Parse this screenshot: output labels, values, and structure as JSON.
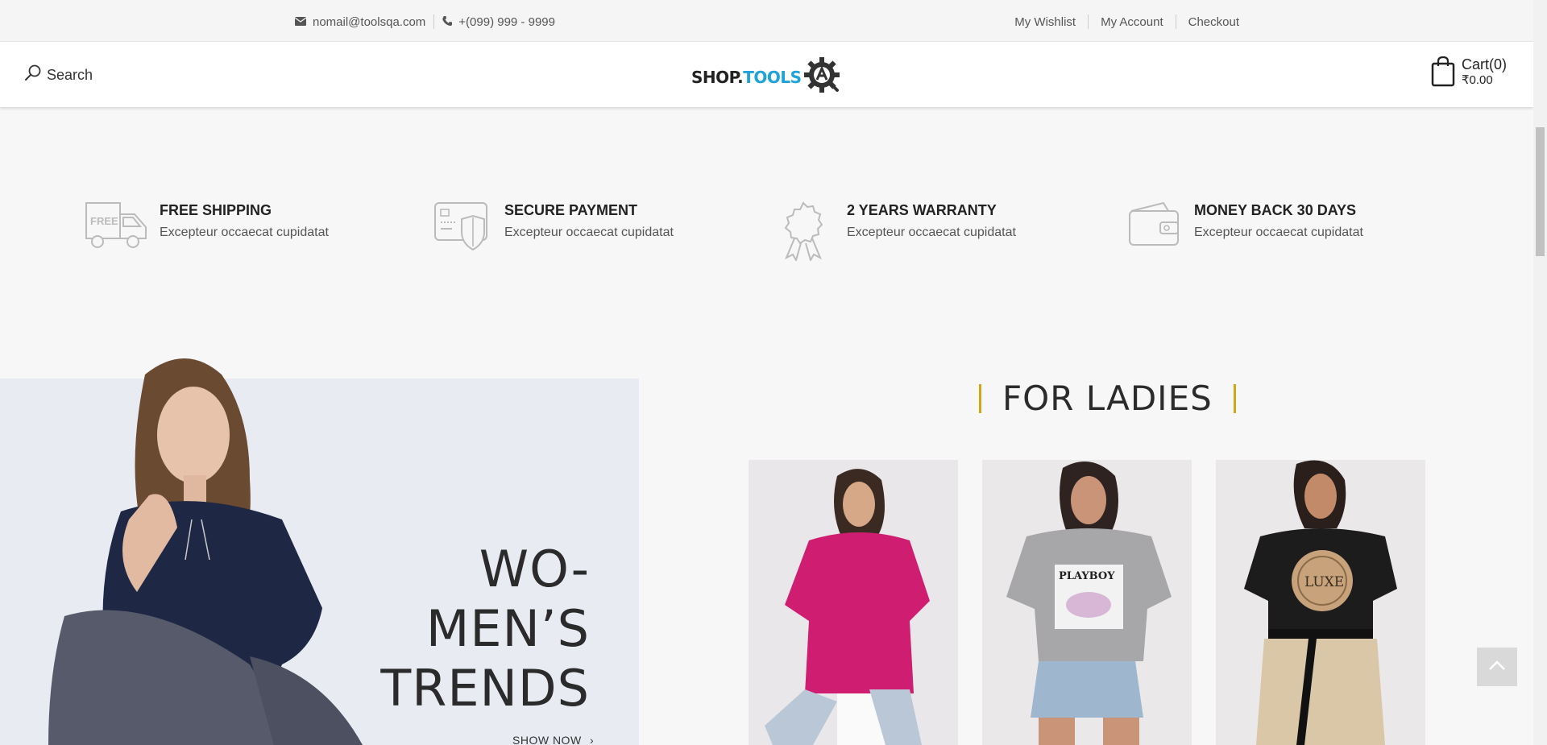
{
  "topbar": {
    "email": "nomail@toolsqa.com",
    "phone": "+(099) 999 - 9999",
    "links": [
      "My Wishlist",
      "My Account",
      "Checkout"
    ]
  },
  "header": {
    "search_label": "Search",
    "logo_shop": "SHOP.",
    "logo_tools": "TOOLS",
    "cart_label": "Cart(0)",
    "cart_total": "₹0.00"
  },
  "features": [
    {
      "title": "FREE SHIPPING",
      "desc": "Excepteur occaecat cupidatat",
      "icon": "truck-icon",
      "badge": "FREE"
    },
    {
      "title": "SECURE PAYMENT",
      "desc": "Excepteur occaecat cupidatat",
      "icon": "card-shield-icon"
    },
    {
      "title": "2 YEARS WARRANTY",
      "desc": "Excepteur occaecat cupidatat",
      "icon": "award-ribbon-icon"
    },
    {
      "title": "MONEY BACK 30 DAYS",
      "desc": "Excepteur occaecat cupidatat",
      "icon": "wallet-icon"
    }
  ],
  "promo": {
    "line1": "WO-",
    "line2": "MEN’S",
    "line3": "TRENDS",
    "cta": "SHOW NOW"
  },
  "ladies": {
    "title": "FOR LADIES"
  },
  "colors": {
    "accent": "#d4a514",
    "logo_blue": "#1ea3d8"
  }
}
